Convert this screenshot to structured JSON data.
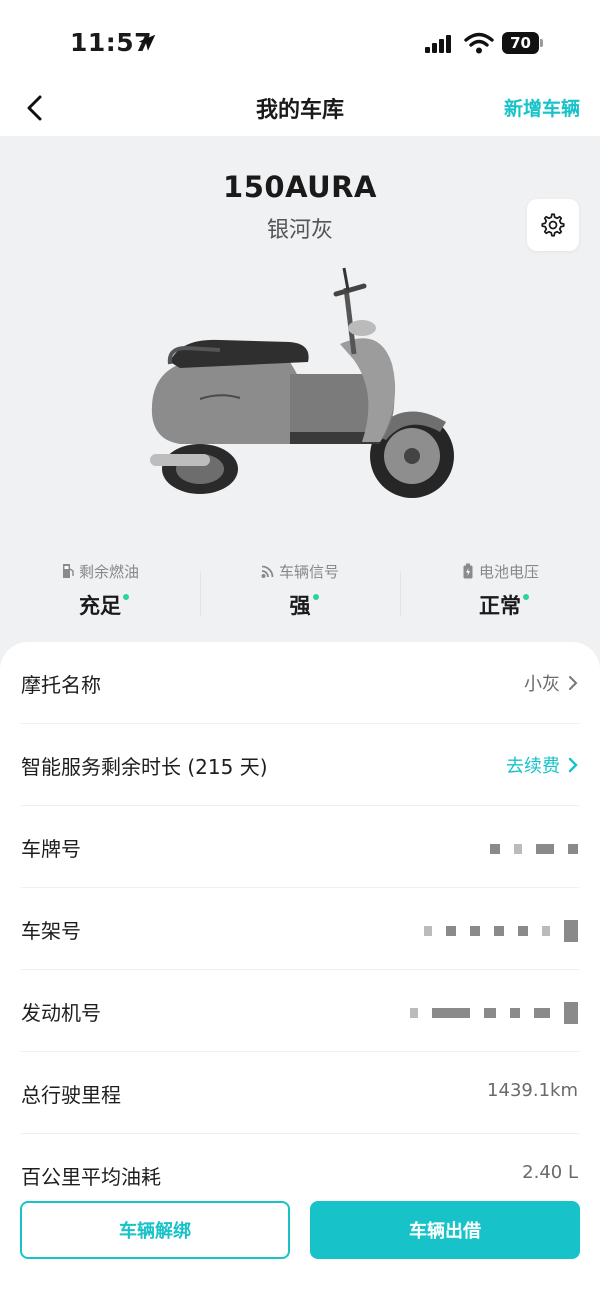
{
  "status_bar": {
    "time": "11:57",
    "battery": "70"
  },
  "nav": {
    "title": "我的车库",
    "action": "新增车辆"
  },
  "vehicle": {
    "model": "150AURA",
    "color_name": "银河灰"
  },
  "stats": [
    {
      "label": "剩余燃油",
      "value": "充足",
      "icon": "fuel-icon"
    },
    {
      "label": "车辆信号",
      "value": "强",
      "icon": "signal-icon"
    },
    {
      "label": "电池电压",
      "value": "正常",
      "icon": "battery-icon"
    }
  ],
  "details": {
    "name": {
      "label": "摩托名称",
      "value": "小灰"
    },
    "service": {
      "label": "智能服务剩余时长 (215 天)",
      "value": "去续费"
    },
    "plate": {
      "label": "车牌号"
    },
    "frame": {
      "label": "车架号"
    },
    "engine": {
      "label": "发动机号"
    },
    "mileage": {
      "label": "总行驶里程",
      "value": "1439.1km"
    },
    "fuel_consumption": {
      "label": "百公里平均油耗",
      "value": "2.40 L"
    }
  },
  "actions": {
    "unbind": "车辆解绑",
    "lend": "车辆出借"
  },
  "colors": {
    "accent": "#17c3c9",
    "status_dot": "#2bd3a0"
  }
}
